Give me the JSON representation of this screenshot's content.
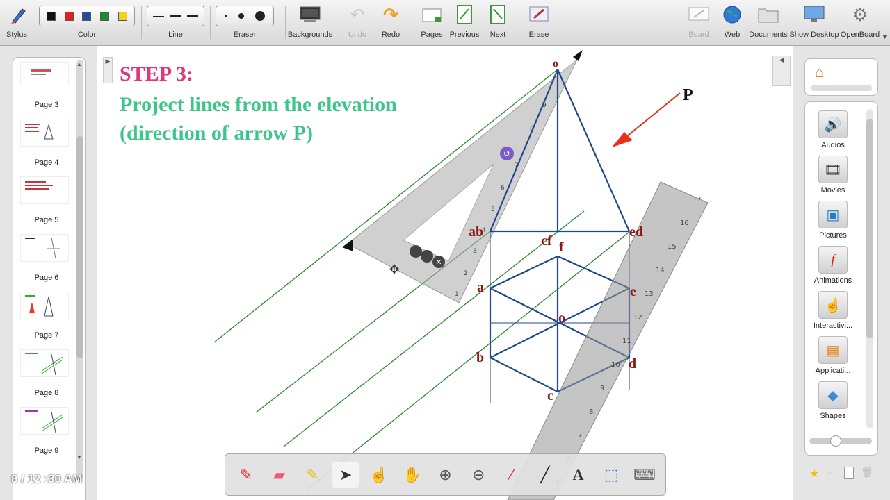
{
  "toolbar": {
    "stylus": "Stylus",
    "color": "Color",
    "line": "Line",
    "eraser": "Eraser",
    "backgrounds": "Backgrounds",
    "undo": "Undo",
    "redo": "Redo",
    "pages": "Pages",
    "previous": "Previous",
    "next": "Next",
    "erase": "Erase",
    "board": "Board",
    "web": "Web",
    "documents": "Documents",
    "show_desktop": "Show Desktop",
    "openboard": "OpenBoard",
    "colors": [
      "#111111",
      "#e02020",
      "#1e4e9a",
      "#1e8a2e",
      "#f2d21a"
    ]
  },
  "thumbnails": {
    "pages": [
      "Page 3",
      "Page 4",
      "Page 5",
      "Page 6",
      "Page 7",
      "Page 8",
      "Page 9"
    ]
  },
  "clock": "8 / 12 :30 AM",
  "board": {
    "step": "STEP 3:",
    "line1": "Project lines from the elevation",
    "line2": "(direction of arrow P)",
    "labels": {
      "o_top": "o",
      "p": "P",
      "ab": "ab",
      "cf": "cf",
      "ed": "ed",
      "f": "f",
      "a": "a",
      "e": "e",
      "o_mid": "o",
      "b": "b",
      "d": "d",
      "c": "c"
    },
    "ruler_numbers": [
      "17",
      "16",
      "15",
      "14",
      "13",
      "12",
      "11",
      "10",
      "9",
      "8",
      "7",
      "6",
      "5"
    ],
    "set_square_numbers": [
      "1",
      "2",
      "3",
      "4",
      "5",
      "6",
      "7",
      "8",
      "9"
    ]
  },
  "library": {
    "items": [
      "Audios",
      "Movies",
      "Pictures",
      "Animations",
      "Interactivi...",
      "Applicati...",
      "Shapes"
    ]
  },
  "colors": {
    "step": "#e0357a",
    "heading": "#3ec58a",
    "drawing": "#1f4a8a",
    "projection": "#2d8a2d",
    "arrow": "#e8301e",
    "label": "#8b1a1a"
  }
}
